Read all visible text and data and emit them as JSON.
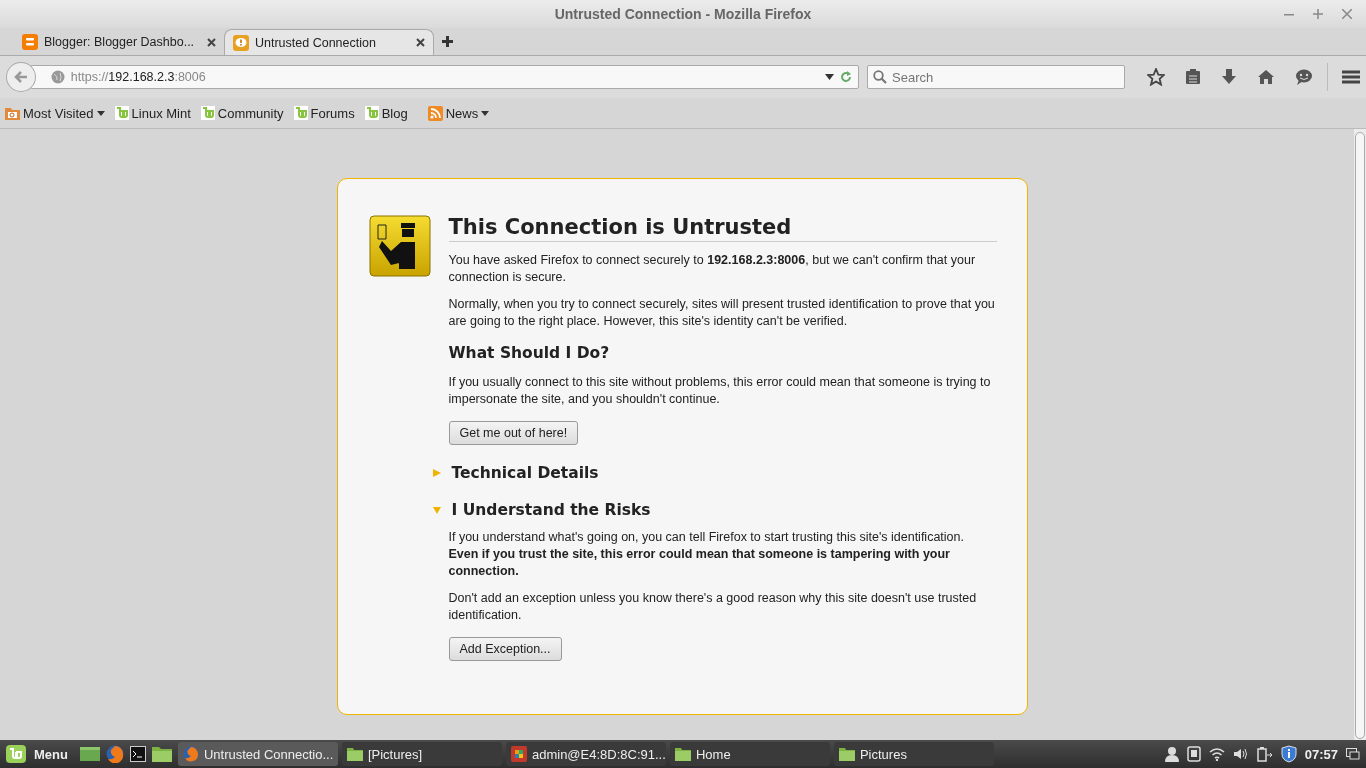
{
  "window": {
    "title": "Untrusted Connection - Mozilla Firefox"
  },
  "tabs": [
    {
      "label": "Blogger: Blogger Dashbo...",
      "selected": false,
      "kind": "blogger"
    },
    {
      "label": "Untrusted Connection",
      "selected": true,
      "kind": "warning"
    }
  ],
  "address": {
    "scheme": "https://",
    "host": "192.168.2.3",
    "port": ":8006"
  },
  "search": {
    "placeholder": "Search"
  },
  "bookmarks": [
    {
      "label": "Most Visited",
      "kind": "folder",
      "menu": true
    },
    {
      "label": "Linux Mint",
      "kind": "mint",
      "menu": false
    },
    {
      "label": "Community",
      "kind": "mint",
      "menu": false
    },
    {
      "label": "Forums",
      "kind": "mint",
      "menu": false
    },
    {
      "label": "Blog",
      "kind": "mint",
      "menu": false
    },
    {
      "label": "News",
      "kind": "rss",
      "menu": true
    }
  ],
  "error": {
    "title": "This Connection is Untrusted",
    "paragraphs": [
      "You have asked Firefox to connect securely to **192.168.2.3:8006**, but we can't confirm that your connection is secure.",
      "Normally, when you try to connect securely, sites will present trusted identification to prove that you are going to the right place. However, this site's identity can't be verified."
    ],
    "subtitle": "What Should I Do?",
    "advice": "If you usually connect to this site without problems, this error could mean that someone is trying to impersonate the site, and you shouldn't continue.",
    "button": "Get me out of here!",
    "sections": [
      {
        "title": "Technical Details",
        "expanded": false
      },
      {
        "title": "I Understand the Risks",
        "expanded": true,
        "paragraphs": [
          "If you understand what's going on, you can tell Firefox to start trusting this site's identification. **Even if you trust the site, this error could mean that someone is tampering with your connection.**",
          "Don't add an exception unless you know there's a good reason why this site doesn't use trusted identification."
        ],
        "button": "Add Exception..."
      }
    ]
  },
  "taskbar": {
    "menu": "Menu",
    "windows": [
      {
        "label": "Untrusted Connectio...",
        "kind": "firefox",
        "selected": true
      },
      {
        "label": "[Pictures]",
        "kind": "folder",
        "selected": false
      },
      {
        "label": "admin@E4:8D:8C:91...",
        "kind": "app",
        "selected": false
      },
      {
        "label": "Home",
        "kind": "folder",
        "selected": false
      },
      {
        "label": "Pictures",
        "kind": "folder",
        "selected": false
      }
    ],
    "clock": "07:57"
  }
}
